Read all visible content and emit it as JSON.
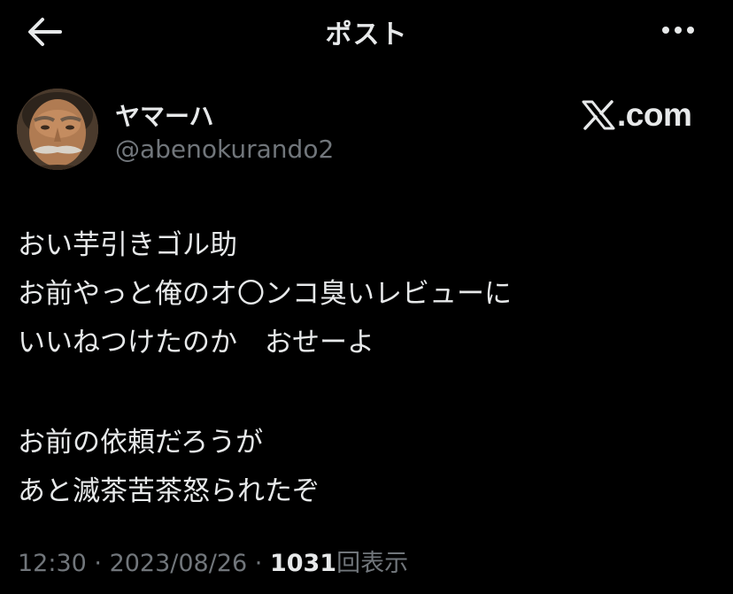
{
  "header": {
    "title": "ポスト",
    "back_icon": "arrow-left-icon",
    "more_icon": "more-horizontal-icon"
  },
  "author": {
    "display_name": "ヤマーハ",
    "handle": "@abenokurando2"
  },
  "watermark": {
    "text": ".com",
    "logo_icon": "x-logo-icon"
  },
  "tweet": {
    "lines": [
      "おい芋引きゴル助",
      "お前やっと俺のオ〇ンコ臭いレビューに",
      "いいねつけたのか　おせーよ",
      "",
      "お前の依頼だろうが",
      "あと滅茶苦茶怒られたぞ"
    ]
  },
  "meta": {
    "time": "12:30",
    "separator": " · ",
    "date": "2023/08/26",
    "views_count": "1031",
    "views_label": "回表示"
  },
  "colors": {
    "background": "#000000",
    "primary_text": "#e7e9ea",
    "secondary_text": "#71767b"
  }
}
